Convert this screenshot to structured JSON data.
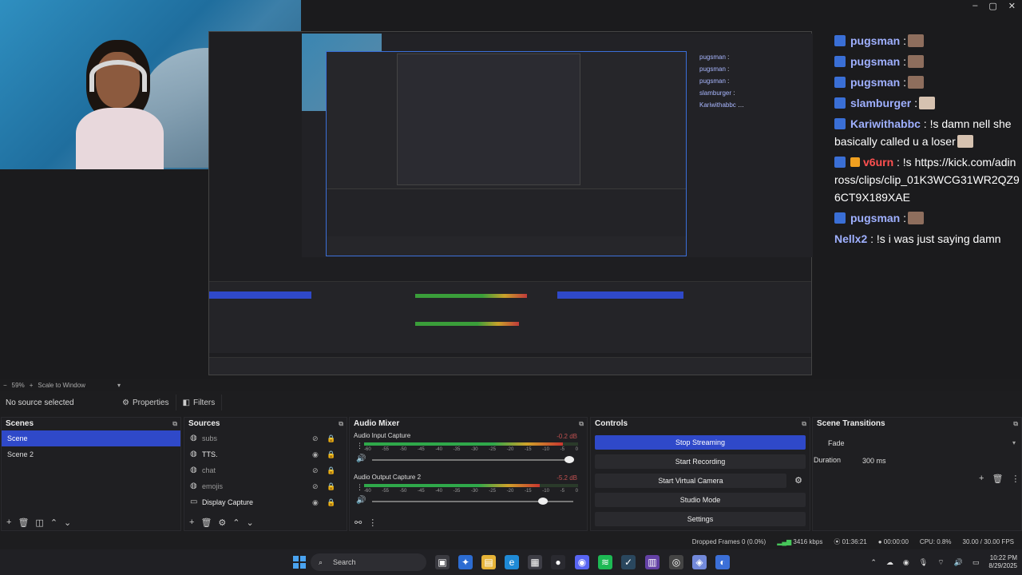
{
  "chat": [
    {
      "user": "pugsman",
      "message": ":",
      "emote": true
    },
    {
      "user": "pugsman",
      "message": ":",
      "emote": true
    },
    {
      "user": "pugsman",
      "message": ":",
      "emote": true
    },
    {
      "user": "slamburger",
      "message": ":",
      "emote": true
    },
    {
      "user": "Kariwithabbc",
      "message": ": !s damn nell she basically called u a loser",
      "emote": true
    },
    {
      "user": "v6urn",
      "message": ": !s https://kick.com/adinross/clips/clip_01K3WCG31WR2QZ96CT9X189XAE",
      "emote": false,
      "red": true
    },
    {
      "user": "pugsman",
      "message": ":",
      "emote": true
    },
    {
      "user": "Nellx2",
      "message": ": !s i was just saying damn",
      "emote": false,
      "plain": true
    }
  ],
  "obs": {
    "zoom": "59%",
    "scale_mode": "Scale to Window",
    "no_source": "No source selected",
    "properties_label": "Properties",
    "filters_label": "Filters",
    "scenes_title": "Scenes",
    "scenes": [
      "Scene",
      "Scene 2"
    ],
    "sources_title": "Sources",
    "sources": [
      {
        "name": "subs",
        "visible": false
      },
      {
        "name": "TTS.",
        "visible": true
      },
      {
        "name": "chat",
        "visible": false
      },
      {
        "name": "emojis",
        "visible": false
      },
      {
        "name": "Display Capture",
        "visible": true
      }
    ],
    "mixer_title": "Audio Mixer",
    "tracks": [
      {
        "name": "Audio Input Capture",
        "db": "-0.2 dB",
        "level": 0.93,
        "volume": 0.98
      },
      {
        "name": "Audio Output Capture 2",
        "db": "-5.2 dB",
        "level": 0.82,
        "volume": 0.85
      }
    ],
    "ticks": [
      "-60",
      "-55",
      "-50",
      "-45",
      "-40",
      "-35",
      "-30",
      "-25",
      "-20",
      "-15",
      "-10",
      "-5",
      "0"
    ],
    "controls_title": "Controls",
    "controls": {
      "stop_streaming": "Stop Streaming",
      "start_recording": "Start Recording",
      "start_virtual_camera": "Start Virtual Camera",
      "studio_mode": "Studio Mode",
      "settings": "Settings"
    },
    "transitions_title": "Scene Transitions",
    "transition": "Fade",
    "duration_label": "Duration",
    "duration_value": "300 ms",
    "status": {
      "dropped": "Dropped Frames 0 (0.0%)",
      "bitrate": "3416 kbps",
      "stream_time": "01:36:21",
      "rec_time": "00:00:00",
      "cpu": "CPU: 0.8%",
      "fps": "30.00 / 30.00 FPS"
    }
  },
  "taskbar": {
    "search_placeholder": "Search",
    "time": "10:22 PM",
    "date": "8/29/2025"
  },
  "colors": {
    "accent": "#2f49c9",
    "chat_user": "#9fb0ff",
    "chat_user_red": "#ff5050"
  }
}
